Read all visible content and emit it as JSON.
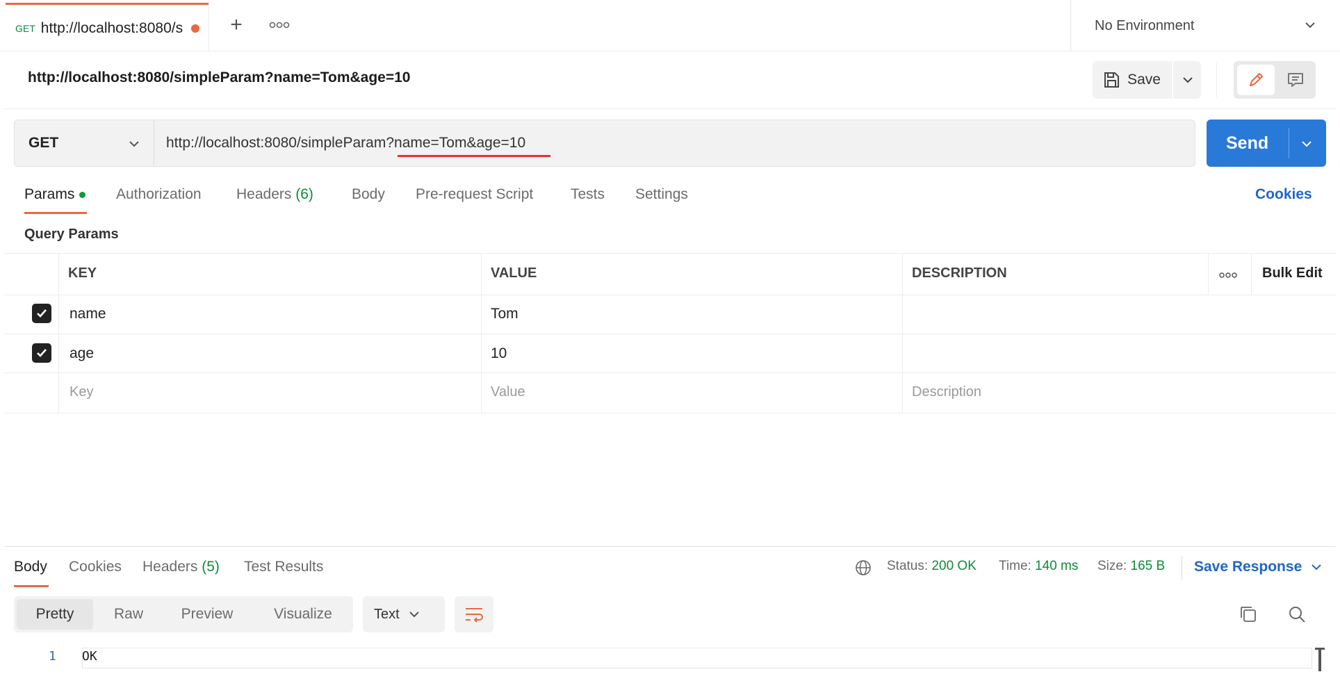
{
  "tabbar": {
    "active_tab": {
      "method": "GET",
      "title": "http://localhost:8080/s",
      "unsaved": true
    },
    "new_tab_symbol": "+",
    "environment": "No Environment"
  },
  "request": {
    "title": "http://localhost:8080/simpleParam?name=Tom&age=10",
    "save_label": "Save",
    "method": "GET",
    "url": "http://localhost:8080/simpleParam?name=Tom&age=10",
    "send_label": "Send"
  },
  "request_tabs": {
    "params": "Params",
    "authorization": "Authorization",
    "headers": "Headers",
    "headers_count": "(6)",
    "body": "Body",
    "pre_request": "Pre-request Script",
    "tests": "Tests",
    "settings": "Settings",
    "cookies": "Cookies"
  },
  "params": {
    "section_title": "Query Params",
    "columns": {
      "key": "KEY",
      "value": "VALUE",
      "description": "DESCRIPTION",
      "bulk_edit": "Bulk Edit"
    },
    "rows": [
      {
        "checked": true,
        "key": "name",
        "value": "Tom",
        "description": ""
      },
      {
        "checked": true,
        "key": "age",
        "value": "10",
        "description": ""
      }
    ],
    "placeholders": {
      "key": "Key",
      "value": "Value",
      "description": "Description"
    }
  },
  "response": {
    "tabs": {
      "body": "Body",
      "cookies": "Cookies",
      "headers": "Headers",
      "headers_count": "(5)",
      "test_results": "Test Results"
    },
    "status_label": "Status:",
    "status_value": "200 OK",
    "time_label": "Time:",
    "time_value": "140 ms",
    "size_label": "Size:",
    "size_value": "165 B",
    "save_response": "Save Response",
    "formats": {
      "pretty": "Pretty",
      "raw": "Raw",
      "preview": "Preview",
      "visualize": "Visualize"
    },
    "language": "Text",
    "line_number": "1",
    "code": "OK"
  },
  "colors": {
    "accent": "#e8693f",
    "send": "#2979d9",
    "link": "#1f66c9",
    "success": "#0b8a3a",
    "url_highlight": "#e5312f"
  },
  "icons": [
    "plus-icon",
    "more-icon",
    "chevron-down-icon",
    "save-icon",
    "pencil-icon",
    "comment-icon",
    "checkbox-icon",
    "globe-icon",
    "copy-icon",
    "search-icon",
    "wrap-lines-icon"
  ]
}
